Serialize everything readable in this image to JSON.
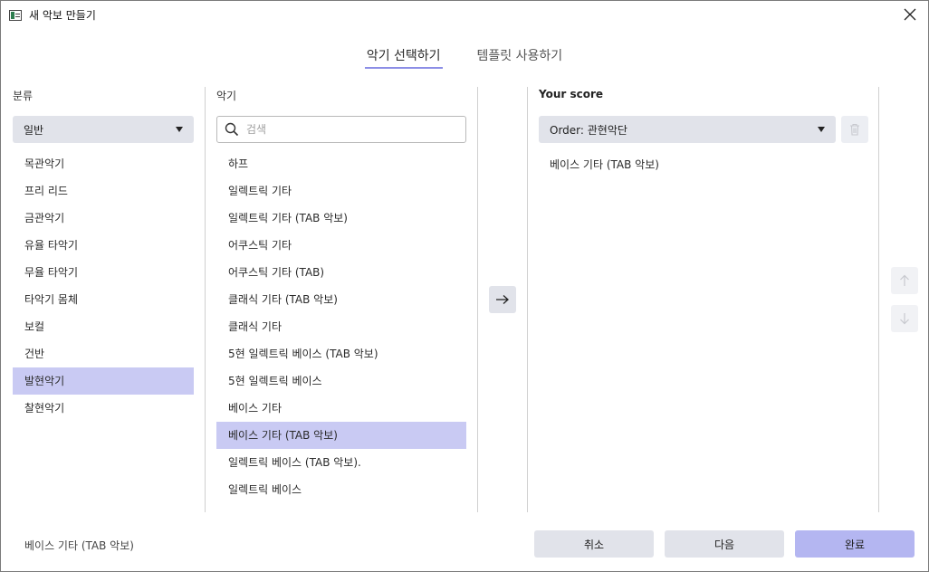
{
  "window": {
    "title": "새 악보 만들기",
    "icon": "app-icon",
    "close_icon": "close-icon"
  },
  "tabs": [
    {
      "label": "악기 선택하기",
      "active": true
    },
    {
      "label": "템플릿 사용하기",
      "active": false
    }
  ],
  "category": {
    "label": "분류",
    "selected": "일반",
    "items": [
      "목관악기",
      "프리 리드",
      "금관악기",
      "유율 타악기",
      "무율 타악기",
      "타악기 몸체",
      "보컬",
      "건반",
      "발현악기",
      "찰현악기"
    ],
    "selected_item": "발현악기"
  },
  "instruments": {
    "label": "악기",
    "search_placeholder": "검색",
    "search_value": "",
    "items": [
      "하프",
      "일렉트릭 기타",
      "일렉트릭 기타 (TAB 악보)",
      "어쿠스틱 기타",
      "어쿠스틱 기타 (TAB)",
      "클래식 기타 (TAB 악보)",
      "클래식 기타",
      "5현 일렉트릭 베이스 (TAB 악보)",
      "5현 일렉트릭 베이스",
      "베이스 기타",
      "베이스 기타 (TAB 악보)",
      "일렉트릭 베이스 (TAB 악보).",
      "일렉트릭 베이스"
    ],
    "selected_item": "베이스 기타 (TAB 악보)"
  },
  "score": {
    "label": "Your score",
    "order_select": "Order: 관현악단",
    "items": [
      "베이스 기타 (TAB 악보)"
    ]
  },
  "footer": {
    "selection_text": "베이스 기타 (TAB 악보)",
    "cancel_label": "취소",
    "next_label": "다음",
    "done_label": "완료"
  },
  "colors": {
    "selection": "#c9caf3",
    "primary_button": "#b4b6f1",
    "tab_underline": "#8c8ee6",
    "button_gray": "#e1e3ea"
  }
}
